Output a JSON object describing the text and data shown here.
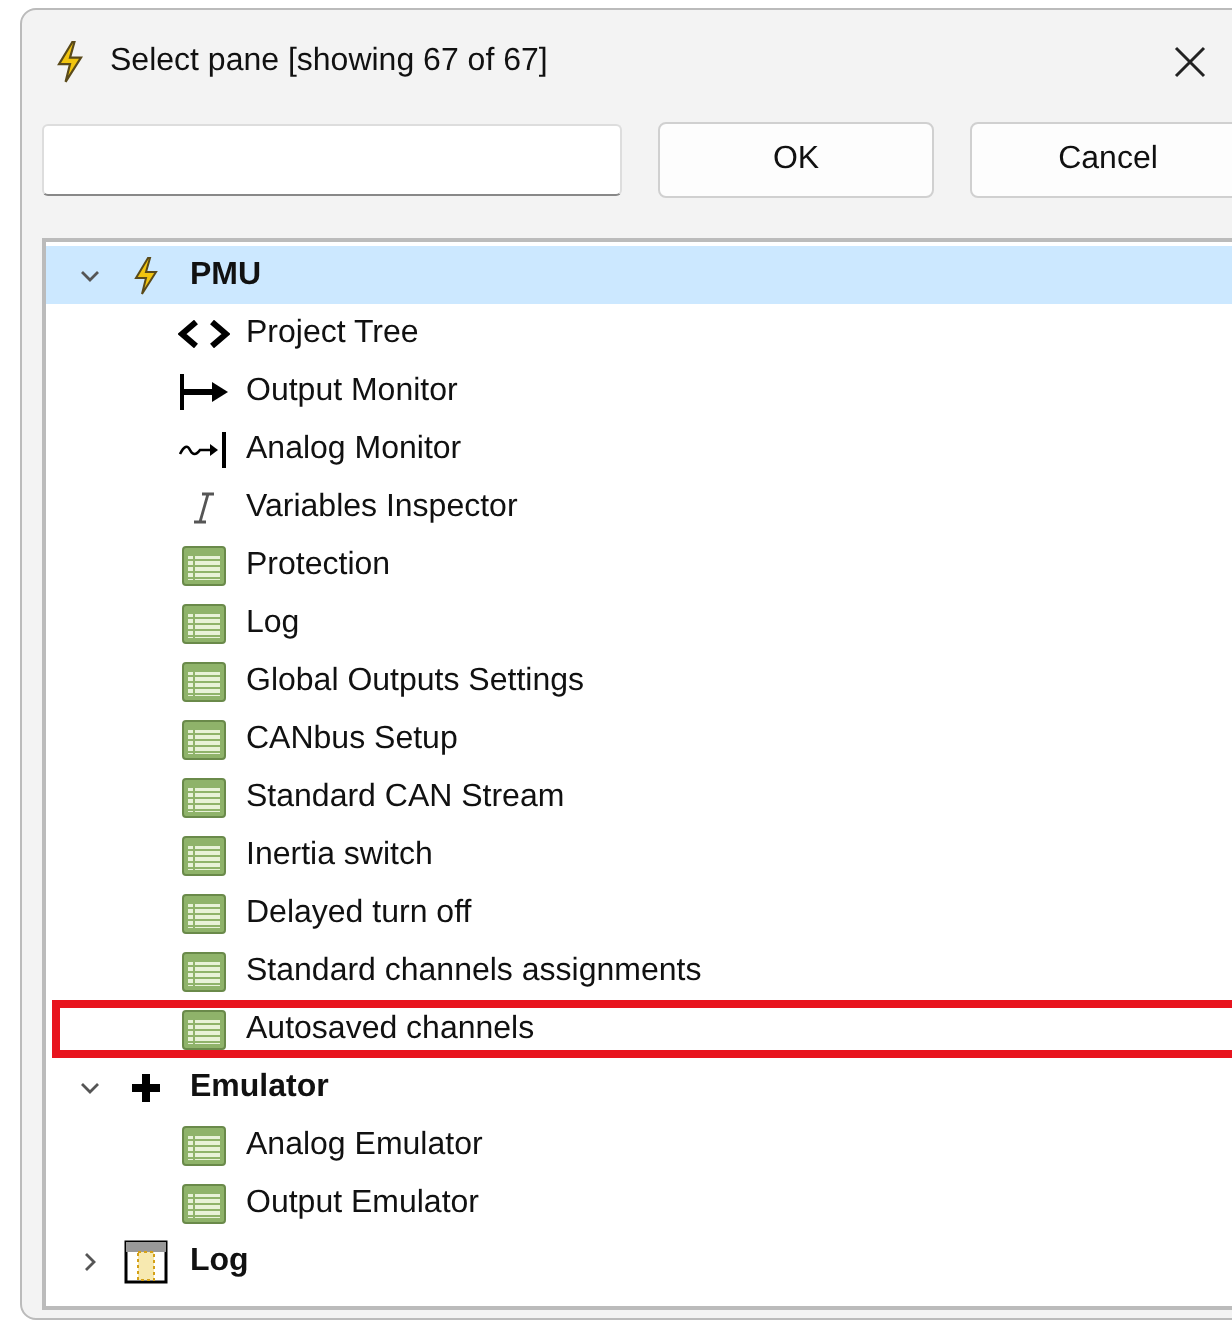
{
  "window": {
    "title": "Select pane [showing 67 of 67]"
  },
  "buttons": [
    "OK",
    "Cancel"
  ],
  "tree": [
    {
      "label": "PMU",
      "kind": "bolt",
      "expanded": true,
      "selected": true,
      "children": [
        {
          "label": "Project Tree",
          "kind": "code",
          "highlighted": false
        },
        {
          "label": "Output Monitor",
          "kind": "output",
          "highlighted": false
        },
        {
          "label": "Analog Monitor",
          "kind": "analog",
          "highlighted": false
        },
        {
          "label": "Variables Inspector",
          "kind": "variable",
          "highlighted": false
        },
        {
          "label": "Protection",
          "kind": "table",
          "highlighted": false
        },
        {
          "label": "Log",
          "kind": "table",
          "highlighted": false
        },
        {
          "label": "Global Outputs Settings",
          "kind": "table",
          "highlighted": false
        },
        {
          "label": "CANbus Setup",
          "kind": "table",
          "highlighted": false
        },
        {
          "label": "Standard CAN Stream",
          "kind": "table",
          "highlighted": false
        },
        {
          "label": "Inertia switch",
          "kind": "table",
          "highlighted": false
        },
        {
          "label": "Delayed turn off",
          "kind": "table",
          "highlighted": false
        },
        {
          "label": "Standard channels assignments",
          "kind": "table",
          "highlighted": false
        },
        {
          "label": "Autosaved channels",
          "kind": "table",
          "highlighted": true
        }
      ]
    },
    {
      "label": "Emulator",
      "kind": "plus",
      "expanded": true,
      "selected": false,
      "children": [
        {
          "label": "Analog Emulator",
          "kind": "table",
          "highlighted": false
        },
        {
          "label": "Output Emulator",
          "kind": "table",
          "highlighted": false
        }
      ]
    },
    {
      "label": "Log",
      "kind": "grid",
      "expanded": false,
      "selected": false
    }
  ]
}
